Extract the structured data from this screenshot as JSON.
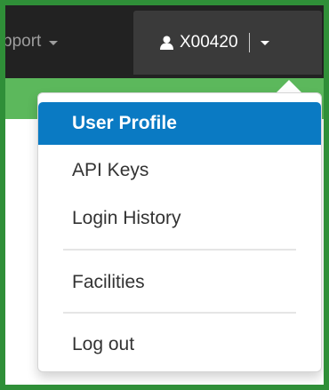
{
  "navbar": {
    "support_label": "pport",
    "user_name": "X00420"
  },
  "dropdown": {
    "items": [
      {
        "label": "User Profile",
        "active": true
      },
      {
        "label": "API Keys"
      },
      {
        "label": "Login History"
      },
      {
        "label": "Facilities"
      },
      {
        "label": "Log out"
      }
    ]
  },
  "colors": {
    "border_green": "#2f8f38",
    "navbar_bg": "#222222",
    "active_item_bg": "#0a7ac3",
    "band_green": "#5cb85c"
  },
  "icons": {
    "user": "user-icon",
    "caret": "caret-down-icon"
  }
}
